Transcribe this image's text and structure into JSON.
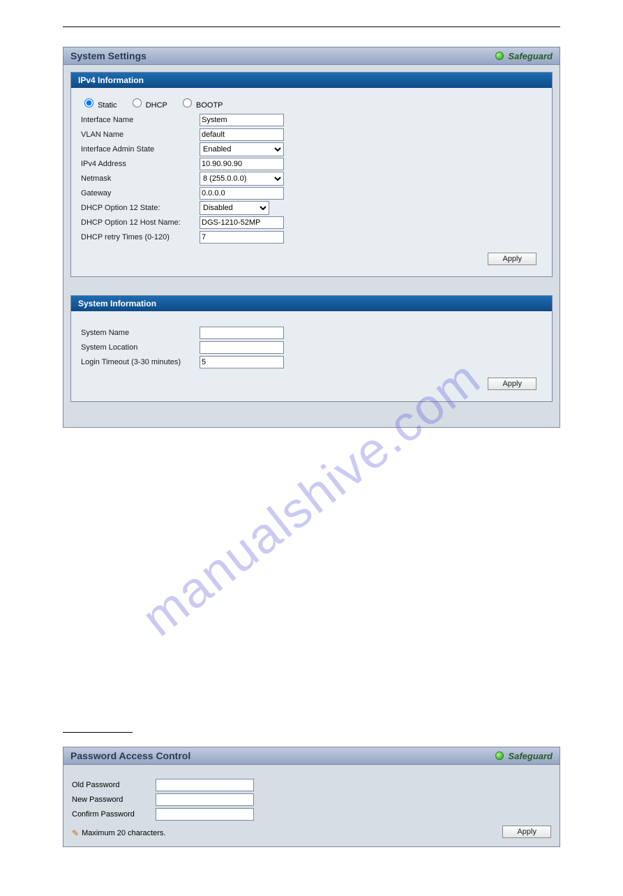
{
  "watermark": "manualshive.com",
  "panel1": {
    "title": "System Settings",
    "safeguard": "Safeguard",
    "ipv4": {
      "header": "IPv4 Information",
      "radio_static": "Static",
      "radio_dhcp": "DHCP",
      "radio_bootp": "BOOTP",
      "interface_name_label": "Interface Name",
      "interface_name_value": "System",
      "vlan_name_label": "VLAN Name",
      "vlan_name_value": "default",
      "admin_state_label": "Interface Admin State",
      "admin_state_value": "Enabled",
      "ipv4_addr_label": "IPv4 Address",
      "ipv4_addr_value": "10.90.90.90",
      "netmask_label": "Netmask",
      "netmask_value": "8 (255.0.0.0)",
      "gateway_label": "Gateway",
      "gateway_value": "0.0.0.0",
      "dhcp12state_label": "DHCP Option 12 State:",
      "dhcp12state_value": "Disabled",
      "dhcp12host_label": "DHCP Option 12 Host Name:",
      "dhcp12host_value": "DGS-1210-52MP",
      "dhcp_retry_label": "DHCP retry Times (0-120)",
      "dhcp_retry_value": "7",
      "apply": "Apply"
    },
    "sysinfo": {
      "header": "System Information",
      "system_name_label": "System Name",
      "system_name_value": "",
      "system_location_label": "System Location",
      "system_location_value": "",
      "login_timeout_label": "Login Timeout (3-30 minutes)",
      "login_timeout_value": "5",
      "apply": "Apply"
    }
  },
  "panel2": {
    "title": "Password Access Control",
    "safeguard": "Safeguard",
    "old_pwd_label": "Old Password",
    "new_pwd_label": "New Password",
    "confirm_pwd_label": "Confirm Password",
    "note": "Maximum 20 characters.",
    "apply": "Apply"
  }
}
